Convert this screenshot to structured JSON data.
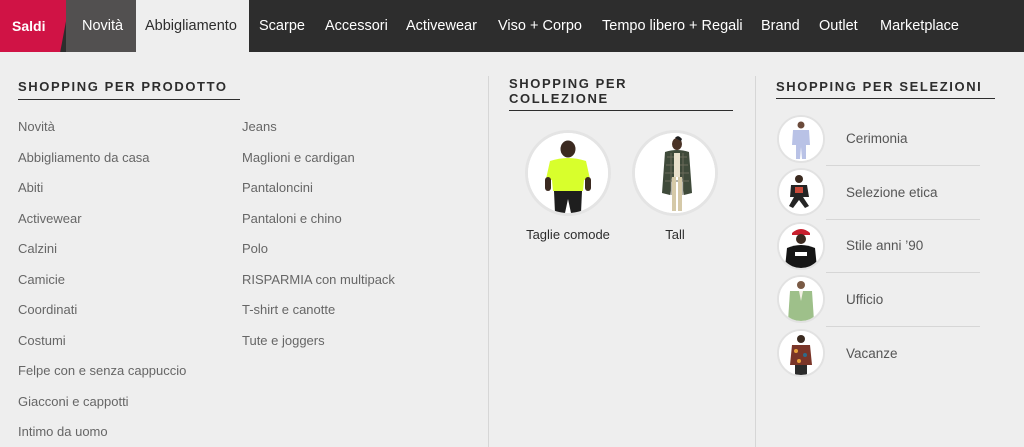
{
  "nav": {
    "sale": "Saldi",
    "items": [
      "Novità",
      "Abbigliamento",
      "Scarpe",
      "Accessori",
      "Activewear",
      "Viso + Corpo",
      "Tempo libero + Regali",
      "Brand",
      "Outlet",
      "Marketplace"
    ],
    "active": "Abbigliamento",
    "colors": {
      "bar": "#2d2d2d",
      "sale": "#d01345",
      "grey_tab": "#525050"
    }
  },
  "product": {
    "heading": "SHOPPING PER PRODOTTO",
    "col1": [
      "Novità",
      "Abbigliamento da casa",
      "Abiti",
      "Activewear",
      "Calzini",
      "Camicie",
      "Coordinati",
      "Costumi",
      "Felpe con e senza cappuccio",
      "Giacconi e cappotti",
      "Intimo da uomo"
    ],
    "col2": [
      "Jeans",
      "Maglioni e cardigan",
      "Pantaloncini",
      "Pantaloni e chino",
      "Polo",
      "RISPARMIA con multipack",
      "T-shirt e canotte",
      "Tute e joggers"
    ]
  },
  "collection": {
    "heading_line1": "SHOPPING PER",
    "heading_line2": "COLLEZIONE",
    "items": [
      {
        "label": "Taglie comode",
        "icon": "plus-size-model-image"
      },
      {
        "label": "Tall",
        "icon": "tall-model-image"
      }
    ]
  },
  "selection": {
    "heading": "SHOPPING PER SELEZIONI",
    "items": [
      {
        "label": "Cerimonia",
        "icon": "suit-model-image"
      },
      {
        "label": "Selezione etica",
        "icon": "ethical-model-image"
      },
      {
        "label": "Stile anni ’90",
        "icon": "nineties-model-image"
      },
      {
        "label": "Ufficio",
        "icon": "office-model-image"
      },
      {
        "label": "Vacanze",
        "icon": "holiday-model-image"
      }
    ]
  }
}
